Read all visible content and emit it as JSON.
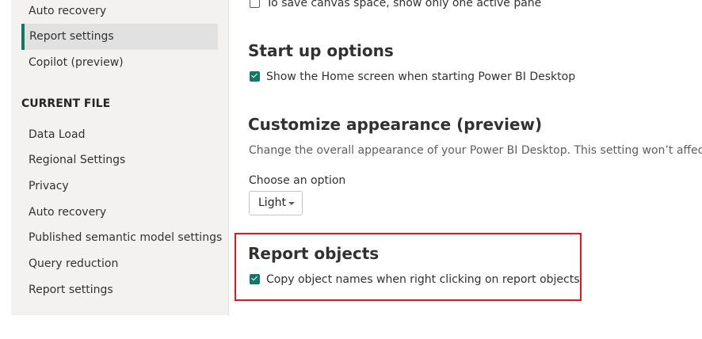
{
  "sidebar": {
    "global_items": [
      {
        "label": "Auto recovery"
      },
      {
        "label": "Report settings",
        "active": true
      },
      {
        "label": "Copilot (preview)"
      }
    ],
    "current_file_heading": "CURRENT FILE",
    "current_file_items": [
      {
        "label": "Data Load"
      },
      {
        "label": "Regional Settings"
      },
      {
        "label": "Privacy"
      },
      {
        "label": "Auto recovery"
      },
      {
        "label": "Published semantic model settings"
      },
      {
        "label": "Query reduction"
      },
      {
        "label": "Report settings"
      }
    ]
  },
  "main": {
    "single_pane_option": {
      "label": "To save canvas space, show only one active pane",
      "checked": false
    },
    "startup": {
      "title": "Start up options",
      "option": {
        "label": "Show the Home screen when starting Power BI Desktop",
        "checked": true
      }
    },
    "appearance": {
      "title": "Customize appearance (preview)",
      "description": "Change the overall appearance of your Power BI Desktop. This setting won’t affect the",
      "choose_label": "Choose an option",
      "selected": "Light"
    },
    "report_objects": {
      "title": "Report objects",
      "option": {
        "label": "Copy object names when right clicking on report objects",
        "checked": true
      }
    }
  },
  "colors": {
    "accent": "#117865",
    "highlight": "#e8141e"
  }
}
